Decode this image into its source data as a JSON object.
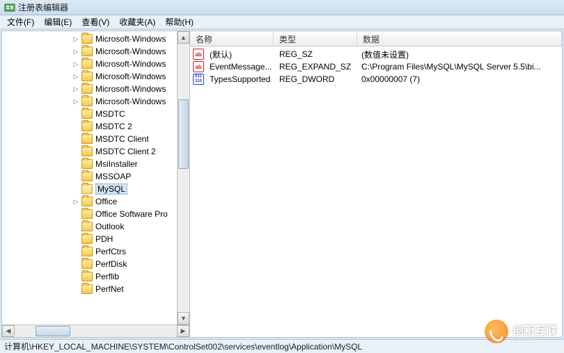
{
  "window": {
    "title": "注册表编辑器"
  },
  "menu": {
    "file": "文件(F)",
    "edit": "编辑(E)",
    "view": "查看(V)",
    "favorites": "收藏夹(A)",
    "help": "帮助(H)"
  },
  "tree": {
    "items": [
      {
        "label": "Microsoft-Windows",
        "depth": 6,
        "expander": "▷"
      },
      {
        "label": "Microsoft-Windows",
        "depth": 6,
        "expander": "▷"
      },
      {
        "label": "Microsoft-Windows",
        "depth": 6,
        "expander": "▷"
      },
      {
        "label": "Microsoft-Windows",
        "depth": 6,
        "expander": "▷"
      },
      {
        "label": "Microsoft-Windows",
        "depth": 6,
        "expander": "▷"
      },
      {
        "label": "Microsoft-Windows",
        "depth": 6,
        "expander": "▷"
      },
      {
        "label": "MSDTC",
        "depth": 6,
        "expander": ""
      },
      {
        "label": "MSDTC 2",
        "depth": 6,
        "expander": ""
      },
      {
        "label": "MSDTC Client",
        "depth": 6,
        "expander": ""
      },
      {
        "label": "MSDTC Client 2",
        "depth": 6,
        "expander": ""
      },
      {
        "label": "MsiInstaller",
        "depth": 6,
        "expander": ""
      },
      {
        "label": "MSSOAP",
        "depth": 6,
        "expander": ""
      },
      {
        "label": "MySQL",
        "depth": 6,
        "expander": "",
        "selected": true,
        "open": true
      },
      {
        "label": "Office",
        "depth": 6,
        "expander": "▷"
      },
      {
        "label": "Office Software Pro",
        "depth": 6,
        "expander": ""
      },
      {
        "label": "Outlook",
        "depth": 6,
        "expander": ""
      },
      {
        "label": "PDH",
        "depth": 6,
        "expander": ""
      },
      {
        "label": "PerfCtrs",
        "depth": 6,
        "expander": ""
      },
      {
        "label": "PerfDisk",
        "depth": 6,
        "expander": ""
      },
      {
        "label": "Perflib",
        "depth": 6,
        "expander": ""
      },
      {
        "label": "PerfNet",
        "depth": 6,
        "expander": ""
      }
    ]
  },
  "list": {
    "columns": {
      "name": "名称",
      "type": "类型",
      "data": "数据"
    },
    "rows": [
      {
        "icon": "sz",
        "iconText": "ab",
        "name": "(默认)",
        "type": "REG_SZ",
        "data": "(数值未设置)"
      },
      {
        "icon": "sz",
        "iconText": "ab",
        "name": "EventMessage...",
        "type": "REG_EXPAND_SZ",
        "data": "C:\\Program Files\\MySQL\\MySQL Server 5.5\\bi..."
      },
      {
        "icon": "dw",
        "iconText": "011\n110",
        "name": "TypesSupported",
        "type": "REG_DWORD",
        "data": "0x00000007 (7)"
      }
    ]
  },
  "statusbar": {
    "path": "计算机\\HKEY_LOCAL_MACHINE\\SYSTEM\\ControlSet002\\services\\eventlog\\Application\\MySQL"
  },
  "watermark": {
    "brand": "创新互联",
    "sub": "CDCXHL.COM"
  }
}
